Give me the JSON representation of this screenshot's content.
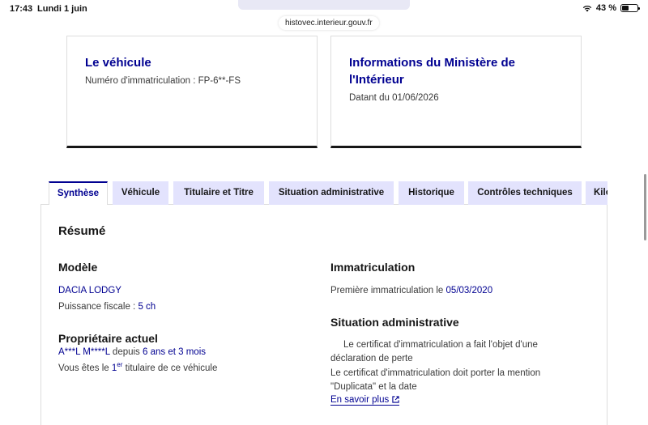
{
  "status_bar": {
    "time": "17:43",
    "date": "Lundi 1 juin",
    "battery": "43 %"
  },
  "browser": {
    "url": "histovec.interieur.gouv.fr"
  },
  "cards": {
    "vehicle": {
      "title": "Le véhicule",
      "text": "Numéro d'immatriculation : FP-6**-FS"
    },
    "ministry": {
      "title": "Informations du Ministère de l'Intérieur",
      "text": "Datant du 01/06/2026"
    }
  },
  "tabs": [
    "Synthèse",
    "Véhicule",
    "Titulaire et Titre",
    "Situation administrative",
    "Historique",
    "Contrôles techniques",
    "Kilo"
  ],
  "summary": {
    "title": "Résumé",
    "model": {
      "heading": "Modèle",
      "name": "DACIA LODGY",
      "power_label": "Puissance fiscale :",
      "power_value": "5 ch"
    },
    "owner": {
      "heading": "Propriétaire actuel",
      "name": "A***L M****L",
      "since_label": "depuis",
      "since_value": "6 ans et 3 mois",
      "rank_prefix": "Vous êtes le",
      "rank_num": "1",
      "rank_sup": "er",
      "rank_suffix": "titulaire de ce véhicule"
    },
    "registration": {
      "heading": "Immatriculation",
      "first_label": "Première immatriculation le",
      "first_date": "05/03/2020"
    },
    "admin": {
      "heading": "Situation administrative",
      "line1": "Le certificat d'immatriculation a fait l'objet d'une",
      "line2": "déclaration de perte",
      "line3": "Le certificat d'immatriculation doit porter la mention",
      "line4": "\"Duplicata\" et la date",
      "link": "En savoir plus"
    }
  }
}
